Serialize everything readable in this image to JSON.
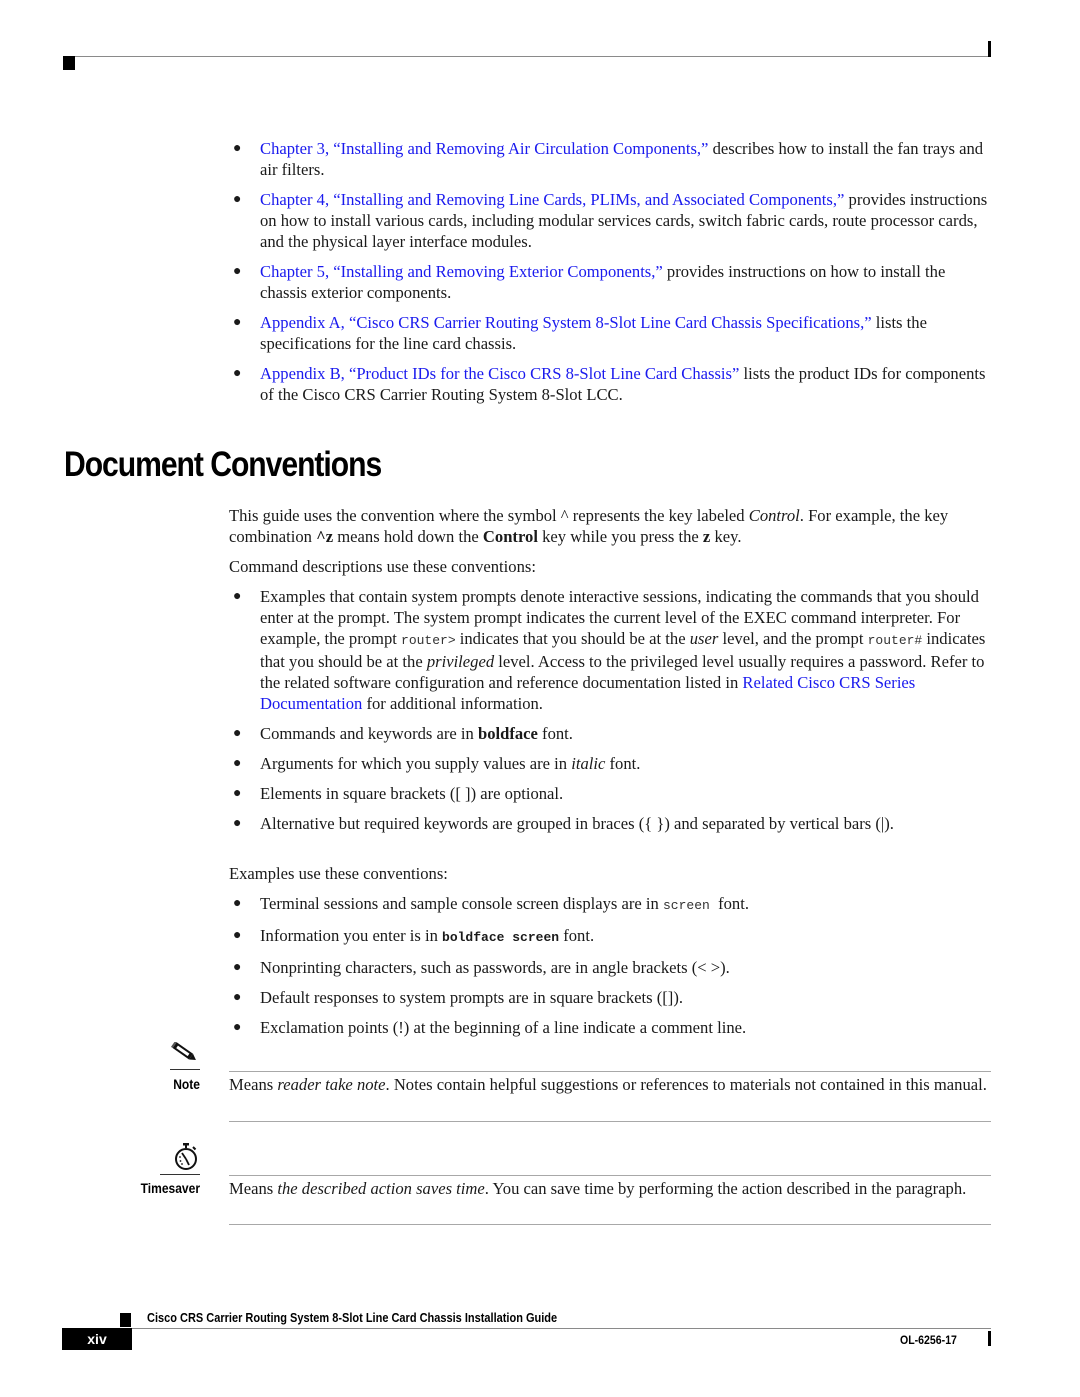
{
  "chapters_list": [
    {
      "link": "Chapter 3, “Installing and Removing Air Circulation Components,”",
      "rest": " describes how to install the fan trays and air filters."
    },
    {
      "link": "Chapter 4, “Installing and Removing Line Cards, PLIMs, and Associated Components,”",
      "rest": " provides instructions on how to install various cards, including modular services cards, switch fabric cards, route processor cards, and the physical layer interface modules."
    },
    {
      "link": "Chapter 5, “Installing and Removing Exterior Components,”",
      "rest": " provides instructions on how to install the chassis exterior components."
    },
    {
      "link": "Appendix A, “Cisco CRS Carrier Routing System 8-Slot Line Card Chassis Specifications,”",
      "rest": " lists the specifications for the line card chassis."
    },
    {
      "link": "Appendix B, “Product IDs for the Cisco CRS 8-Slot Line Card Chassis”",
      "rest": " lists the product IDs for components of the Cisco CRS Carrier Routing System 8-Slot LCC."
    }
  ],
  "section": {
    "title": "Document Conventions",
    "intro": {
      "p1": "This guide uses the convention where the symbol ^ represents the key labeled ",
      "p1_italic": "Control",
      "p2": ". For example, the key combination ",
      "p2_bold": "^z",
      "p3": " means hold down the ",
      "p3_bold": "Control",
      "p4": " key while you press the ",
      "p4_bold": "z",
      "p5": " key."
    },
    "command_lead": "Command descriptions use these conventions:",
    "command_bullets": {
      "b1": {
        "t1": "Examples that contain system prompts denote interactive sessions, indicating the commands that you should enter at the prompt. The system prompt indicates the current level of the EXEC command interpreter. For example, the prompt ",
        "code1": "router>",
        "t2": " indicates that you should be at the ",
        "i1": "user",
        "t3": " level, and the prompt ",
        "code2": "router#",
        "t4": " indicates that you should be at the ",
        "i2": "privileged",
        "t5": " level. Access to the privileged level usually requires a password. Refer to the related software configuration and reference documentation listed in ",
        "link": "Related Cisco CRS Series Documentation",
        "t6": " for additional information."
      },
      "b2": {
        "t1": "Commands and keywords are in ",
        "bold": "boldface",
        "t2": " font."
      },
      "b3": {
        "t1": "Arguments for which you supply values are in ",
        "italic": "italic",
        "t2": " font."
      },
      "b4": "Elements in square brackets ([ ]) are optional.",
      "b5": "Alternative but required keywords are grouped in braces ({ }) and separated by vertical bars (|)."
    },
    "examples_lead": "Examples use these conventions:",
    "example_bullets": {
      "b1": {
        "t1": "Terminal sessions and sample console screen displays are in ",
        "code": "screen",
        "t2": " font."
      },
      "b2": {
        "t1": "Information you enter is in ",
        "code_bold": "boldface screen",
        "t2": " font."
      },
      "b3": "Nonprinting characters, such as passwords, are in angle brackets (< >).",
      "b4": "Default responses to system prompts are in square brackets ([]).",
      "b5": "Exclamation points (!) at the beginning of a line indicate a comment line."
    }
  },
  "note": {
    "label": "Note",
    "icon": "pencil-icon",
    "t1": "Means ",
    "italic": "reader take note",
    "t2": ". Notes contain helpful suggestions or references to materials not contained in this manual."
  },
  "timesaver": {
    "label": "Timesaver",
    "icon": "stopwatch-icon",
    "t1": "Means ",
    "italic": "the described action saves time",
    "t2": ". You can save time by performing the action described in the paragraph."
  },
  "footer": {
    "guide_title": "Cisco CRS Carrier Routing System 8-Slot Line Card Chassis Installation Guide",
    "page_number": "xiv",
    "doc_number": "OL-6256-17"
  },
  "colors": {
    "link": "#1a1aee",
    "text": "#1a1a1a",
    "rule": "#a8a8a8"
  }
}
